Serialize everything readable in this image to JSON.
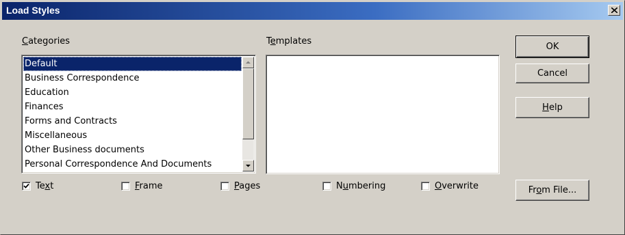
{
  "window": {
    "title": "Load Styles"
  },
  "categories": {
    "label_pre": "",
    "label_key": "C",
    "label_post": "ategories",
    "items": [
      {
        "label": "Default",
        "selected": true
      },
      {
        "label": "Business Correspondence",
        "selected": false
      },
      {
        "label": "Education",
        "selected": false
      },
      {
        "label": "Finances",
        "selected": false
      },
      {
        "label": "Forms and Contracts",
        "selected": false
      },
      {
        "label": "Miscellaneous",
        "selected": false
      },
      {
        "label": "Other Business documents",
        "selected": false
      },
      {
        "label": "Personal Correspondence And Documents",
        "selected": false
      }
    ]
  },
  "templates": {
    "label_pre": "T",
    "label_key": "e",
    "label_post": "mplates",
    "items": []
  },
  "buttons": {
    "ok": "OK",
    "cancel": "Cancel",
    "help_key": "H",
    "help_post": "elp",
    "from_file_pre": "Fr",
    "from_file_key": "o",
    "from_file_post": "m File..."
  },
  "checkboxes": {
    "text": {
      "pre": "Te",
      "key": "x",
      "post": "t",
      "checked": true
    },
    "frame": {
      "pre": "",
      "key": "F",
      "post": "rame",
      "checked": false
    },
    "pages": {
      "pre": "",
      "key": "P",
      "post": "ages",
      "checked": false
    },
    "numbering": {
      "pre": "N",
      "key": "u",
      "post": "mbering",
      "checked": false
    },
    "overwrite": {
      "pre": "",
      "key": "O",
      "post": "verwrite",
      "checked": false
    }
  },
  "icons": {
    "close": "close-icon",
    "scroll_up": "arrow-up-icon",
    "scroll_down": "arrow-down-icon",
    "check": "checkmark-icon"
  }
}
